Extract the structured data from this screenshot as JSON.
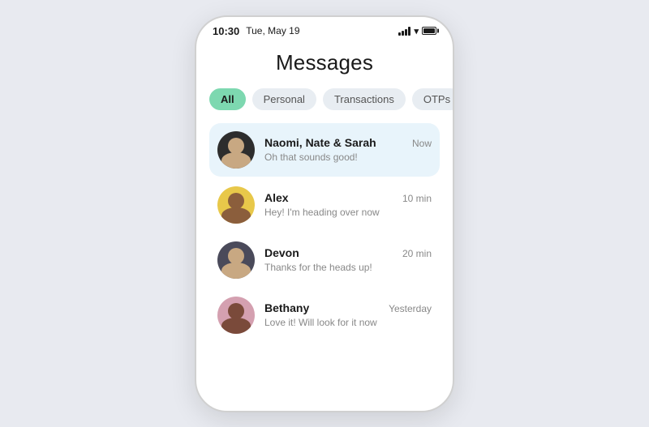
{
  "statusBar": {
    "time": "10:30",
    "date": "Tue, May 19"
  },
  "page": {
    "title": "Messages"
  },
  "filterTabs": {
    "all": "All",
    "personal": "Personal",
    "transactions": "Transactions",
    "otps": "OTPs"
  },
  "conversations": [
    {
      "id": "naomi-nate-sarah",
      "name": "Naomi, Nate & Sarah",
      "time": "Now",
      "preview": "Oh that sounds good!",
      "highlighted": true
    },
    {
      "id": "alex",
      "name": "Alex",
      "time": "10 min",
      "preview": "Hey! I'm heading over now",
      "highlighted": false
    },
    {
      "id": "devon",
      "name": "Devon",
      "time": "20 min",
      "preview": "Thanks for the heads up!",
      "highlighted": false
    },
    {
      "id": "bethany",
      "name": "Bethany",
      "time": "Yesterday",
      "preview": "Love it! Will look for it now",
      "highlighted": false
    }
  ]
}
